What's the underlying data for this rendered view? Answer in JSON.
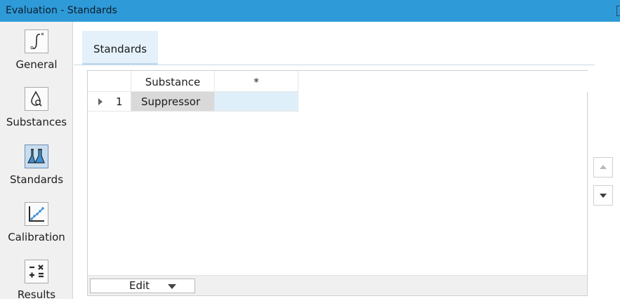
{
  "window": {
    "title": "Evaluation - Standards"
  },
  "sidebar": {
    "items": [
      {
        "label": "General",
        "icon": "integral-icon",
        "active": false
      },
      {
        "label": "Substances",
        "icon": "drop-search-icon",
        "active": false
      },
      {
        "label": "Standards",
        "icon": "flasks-icon",
        "active": true
      },
      {
        "label": "Calibration",
        "icon": "calibration-curve-icon",
        "active": false
      },
      {
        "label": "Results",
        "icon": "calculator-icon",
        "active": false
      }
    ]
  },
  "tabs": [
    {
      "label": "Standards",
      "active": true
    }
  ],
  "grid": {
    "columns": [
      "Substance",
      "*"
    ],
    "rows": [
      {
        "index": "1",
        "substance": "Suppressor",
        "value": ""
      }
    ]
  },
  "footer": {
    "edit_label": "Edit"
  },
  "colors": {
    "titlebar": "#2f9ad8",
    "accent": "#3b8fd6",
    "tab_bg": "#e4f1fb"
  }
}
